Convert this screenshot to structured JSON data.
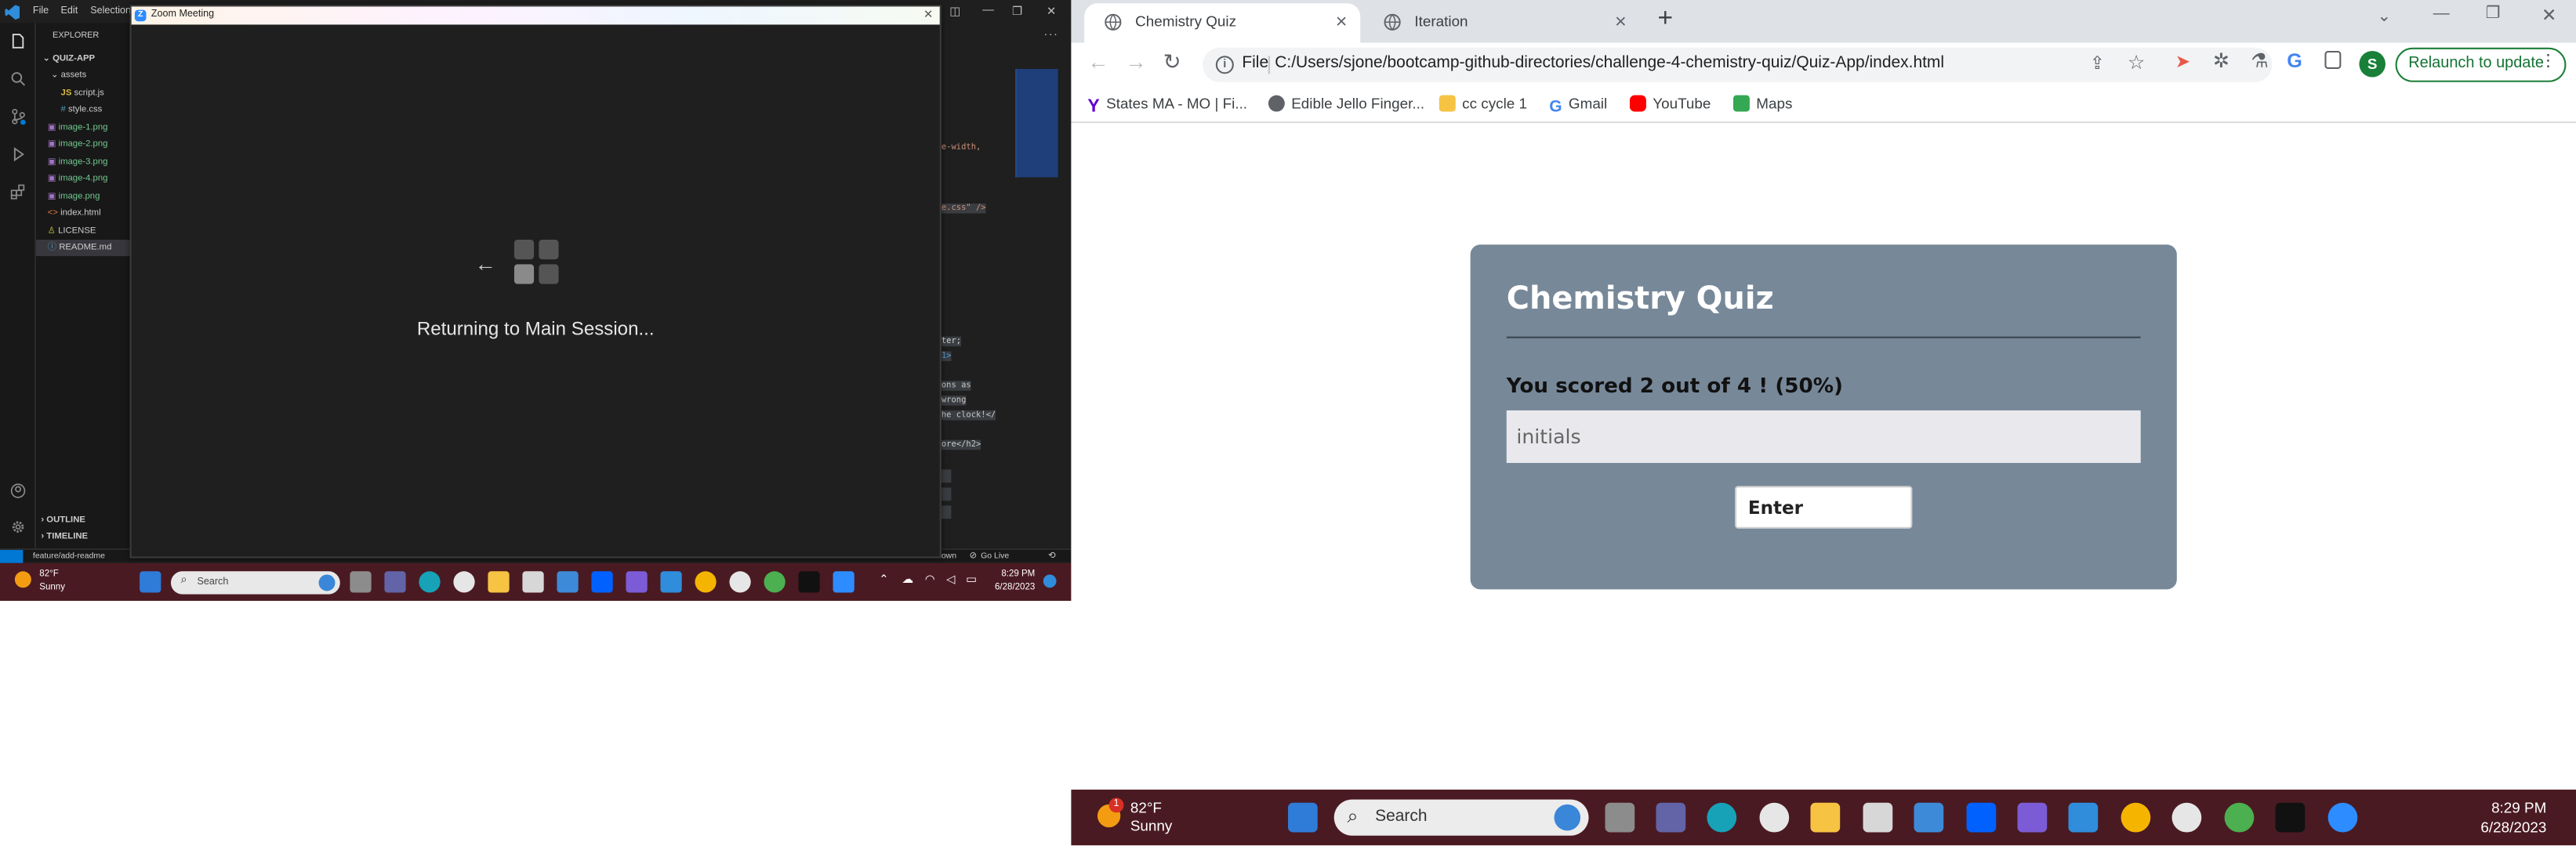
{
  "vscode": {
    "menu": [
      "File",
      "Edit",
      "Selection"
    ],
    "explorer_header": "EXPLORER",
    "project": "QUIZ-APP",
    "tree": [
      {
        "name": "assets",
        "kind": "folder"
      },
      {
        "name": "script.js",
        "kind": "js"
      },
      {
        "name": "style.css",
        "kind": "css"
      },
      {
        "name": "image-1.png",
        "kind": "img"
      },
      {
        "name": "image-2.png",
        "kind": "img"
      },
      {
        "name": "image-3.png",
        "kind": "img"
      },
      {
        "name": "image-4.png",
        "kind": "img"
      },
      {
        "name": "image.png",
        "kind": "img"
      },
      {
        "name": "index.html",
        "kind": "html"
      },
      {
        "name": "LICENSE",
        "kind": "license"
      },
      {
        "name": "README.md",
        "kind": "md"
      }
    ],
    "outline": "OUTLINE",
    "timeline": "TIMELINE",
    "code_fragments": [
      "e-width,",
      "e.css\" />",
      "ter;",
      "1>",
      "ons as",
      "wrong",
      "he clock!</",
      "ore</h2>"
    ],
    "status_branch": "feature/add-readme",
    "status_right": "Go Live",
    "status_mid": "own"
  },
  "zoom": {
    "window_title": "Zoom Meeting",
    "message": "Returning to Main Session..."
  },
  "left_taskbar": {
    "temp": "82°F",
    "weather": "Sunny",
    "search_placeholder": "Search",
    "time": "8:29 PM",
    "date": "6/28/2023"
  },
  "chrome": {
    "tabs": [
      {
        "title": "Chemistry Quiz",
        "active": true
      },
      {
        "title": "Iteration",
        "active": false
      }
    ],
    "url_scheme": "File",
    "url": "C:/Users/sjone/bootcamp-github-directories/challenge-4-chemistry-quiz/Quiz-App/index.html",
    "relaunch": "Relaunch to update",
    "profile_initial": "S",
    "bookmarks": [
      {
        "label": "States MA - MO | Fi...",
        "icon": "yahoo-icon",
        "color": "#6001d2"
      },
      {
        "label": "Edible Jello Finger...",
        "icon": "globe-icon",
        "color": "#5f6368"
      },
      {
        "label": "cc cycle 1",
        "icon": "folder-icon",
        "color": "#f6c343"
      },
      {
        "label": "Gmail",
        "icon": "google-icon",
        "color": "#4285f4"
      },
      {
        "label": "YouTube",
        "icon": "youtube-icon",
        "color": "#ff0000"
      },
      {
        "label": "Maps",
        "icon": "maps-icon",
        "color": "#34a853"
      }
    ]
  },
  "quiz": {
    "title": "Chemistry Quiz",
    "score_text": "You scored 2 out of 4 ! (50%)",
    "initials_placeholder": "initials",
    "enter_label": "Enter",
    "card_color": "#778899"
  },
  "right_taskbar": {
    "temp": "82°F",
    "weather": "Sunny",
    "badge": "1",
    "search_placeholder": "Search",
    "time": "8:29 PM",
    "date": "6/28/2023"
  }
}
